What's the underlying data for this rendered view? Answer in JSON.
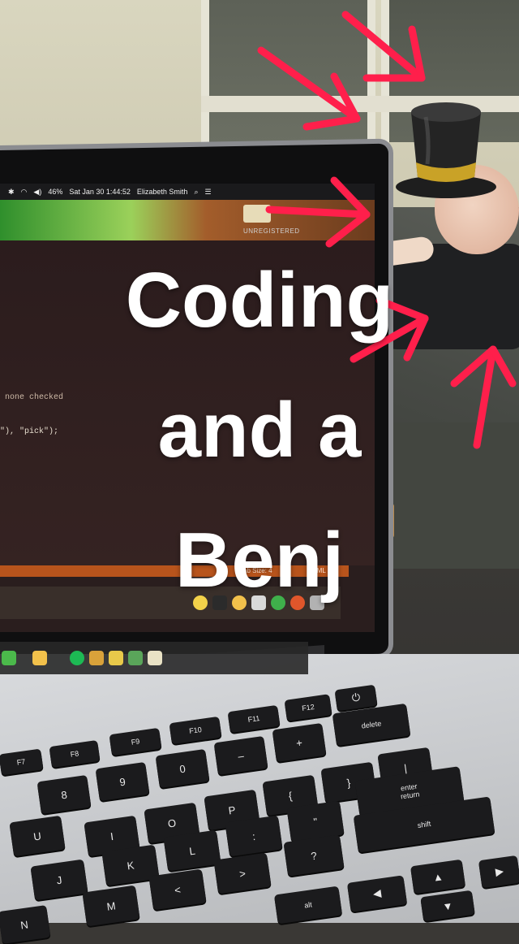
{
  "caption": {
    "line1": "Coding",
    "line2": "and a",
    "line3": "Benj"
  },
  "menubar": {
    "battery": "46%",
    "datetime": "Sat Jan 30  1:44:52",
    "user": "Elizabeth Smith"
  },
  "editor": {
    "unregistered": "UNREGISTERED",
    "code_line_1": "none checked",
    "code_line_2": "\"), \"pick\");",
    "tab_size": "Tab Size: 4",
    "syntax": "HTML"
  },
  "keyboard": {
    "keys": {
      "f7": "F7",
      "f8": "F8",
      "f9": "F9",
      "f10": "F10",
      "f11": "F11",
      "f12": "F12",
      "power": "⏻",
      "eight": "8",
      "nine": "9",
      "zero": "0",
      "minus": "–",
      "plus": "+",
      "delete": "delete",
      "i": "I",
      "o": "O",
      "p": "P",
      "brace_open": "{",
      "brace_close": "}",
      "pipe": "|",
      "k": "K",
      "l": "L",
      "colon": ":",
      "quote": "\"",
      "enter": "enter",
      "return": "return",
      "m": "M",
      "lt": "<",
      "gt": ">",
      "question": "?",
      "shift": "shift",
      "alt": "alt",
      "u": "U",
      "j": "J",
      "n": "N"
    }
  },
  "colors": {
    "caption_text": "#ffffff",
    "arrow_stroke": "#ff1f4b",
    "statusbar": "#b8541c"
  },
  "stickers": [
    "top-hat-emoji",
    "arrows"
  ]
}
